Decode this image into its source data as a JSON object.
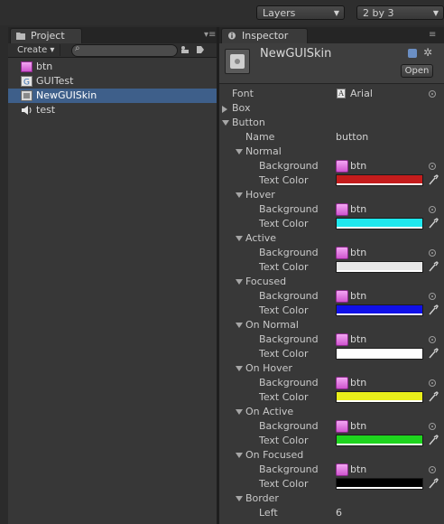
{
  "toolbar": {
    "layers_label": "Layers",
    "layout_label": "2 by 3"
  },
  "project_panel": {
    "tab_label": "Project",
    "create_label": "Create",
    "search_placeholder": "",
    "assets": [
      {
        "name": "btn",
        "icon": "texture-icon",
        "selected": false
      },
      {
        "name": "GUITest",
        "icon": "script-icon",
        "selected": false
      },
      {
        "name": "NewGUISkin",
        "icon": "guiskin-icon",
        "selected": true
      },
      {
        "name": "test",
        "icon": "audio-icon",
        "selected": false
      }
    ]
  },
  "inspector": {
    "tab_label": "Inspector",
    "object_name": "NewGUISkin",
    "open_label": "Open",
    "font": {
      "label": "Font",
      "value": "Arial"
    },
    "box_label": "Box",
    "button_label": "Button",
    "name_label": "Name",
    "name_value": "button",
    "background_label": "Background",
    "text_color_label": "Text Color",
    "states": [
      {
        "label": "Normal",
        "background": "btn",
        "text_color": "#c41c1c"
      },
      {
        "label": "Hover",
        "background": "btn",
        "text_color": "#1ee8ee"
      },
      {
        "label": "Active",
        "background": "btn",
        "text_color": "#e6e6e6"
      },
      {
        "label": "Focused",
        "background": "btn",
        "text_color": "#1010e8"
      },
      {
        "label": "On Normal",
        "background": "btn",
        "text_color": "#ffffff"
      },
      {
        "label": "On Hover",
        "background": "btn",
        "text_color": "#e8ee1a"
      },
      {
        "label": "On Active",
        "background": "btn",
        "text_color": "#1ed41e"
      },
      {
        "label": "On Focused",
        "background": "btn",
        "text_color": "#000000"
      }
    ],
    "border": {
      "label": "Border",
      "left_label": "Left",
      "left_value": "6"
    }
  }
}
